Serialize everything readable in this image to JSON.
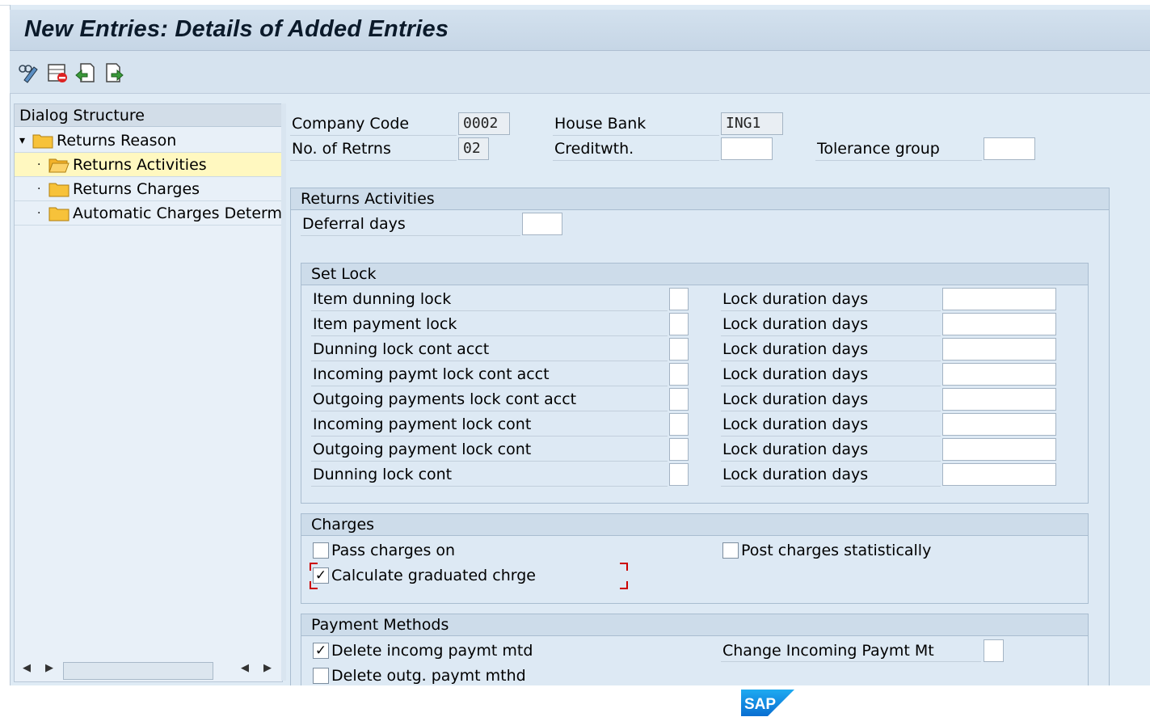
{
  "window": {
    "title": "New Entries: Details of Added Entries"
  },
  "toolbar": {
    "icons": [
      "display-change-icon",
      "delete-icon",
      "undo-icon",
      "next-entry-icon"
    ]
  },
  "tree": {
    "header": "Dialog Structure",
    "items": [
      {
        "label": "Returns Reason",
        "level": 0,
        "expanded": true
      },
      {
        "label": "Returns Activities",
        "level": 1,
        "selected": true
      },
      {
        "label": "Returns Charges",
        "level": 1
      },
      {
        "label": "Automatic Charges Determina",
        "level": 1
      }
    ]
  },
  "header_fields": {
    "company_code_label": "Company Code",
    "company_code_value": "0002",
    "house_bank_label": "House Bank",
    "house_bank_value": "ING1",
    "no_of_returns_label": "No. of Retrns",
    "no_of_returns_value": "02",
    "creditworthiness_label": "Creditwth.",
    "creditworthiness_value": "",
    "tolerance_group_label": "Tolerance group",
    "tolerance_group_value": ""
  },
  "returns_activities": {
    "title": "Returns Activities",
    "deferral_days_label": "Deferral days",
    "deferral_days_value": ""
  },
  "set_lock": {
    "title": "Set Lock",
    "rows": [
      {
        "label": "Item dunning lock",
        "checked": false,
        "duration_label": "Lock duration days",
        "duration": ""
      },
      {
        "label": "Item payment lock",
        "checked": false,
        "duration_label": "Lock duration days",
        "duration": ""
      },
      {
        "label": "Dunning lock cont acct",
        "checked": false,
        "duration_label": "Lock duration days",
        "duration": ""
      },
      {
        "label": "Incoming paymt lock cont acct",
        "checked": false,
        "duration_label": "Lock duration days",
        "duration": ""
      },
      {
        "label": "Outgoing payments lock cont acct",
        "checked": false,
        "duration_label": "Lock duration days",
        "duration": ""
      },
      {
        "label": "Incoming payment lock cont",
        "checked": false,
        "duration_label": "Lock duration days",
        "duration": ""
      },
      {
        "label": "Outgoing payment lock cont",
        "checked": false,
        "duration_label": "Lock duration days",
        "duration": ""
      },
      {
        "label": "Dunning lock cont",
        "checked": false,
        "duration_label": "Lock duration days",
        "duration": ""
      }
    ]
  },
  "charges": {
    "title": "Charges",
    "pass_charges_on_label": "Pass charges on",
    "pass_charges_on_checked": "",
    "post_statistically_label": "Post charges statistically",
    "post_statistically_checked": "",
    "calc_graduated_label": "Calculate graduated chrge",
    "calc_graduated_checked": "✓"
  },
  "payment_methods": {
    "title": "Payment Methods",
    "delete_incoming_label": "Delete incomg paymt mtd",
    "delete_incoming_checked": "✓",
    "delete_outgoing_label": "Delete outg. paymt mthd",
    "delete_outgoing_checked": "",
    "change_incoming_label": "Change Incoming Paymt Mt",
    "change_incoming_value": ""
  },
  "branding": {
    "logo": "SAP"
  }
}
